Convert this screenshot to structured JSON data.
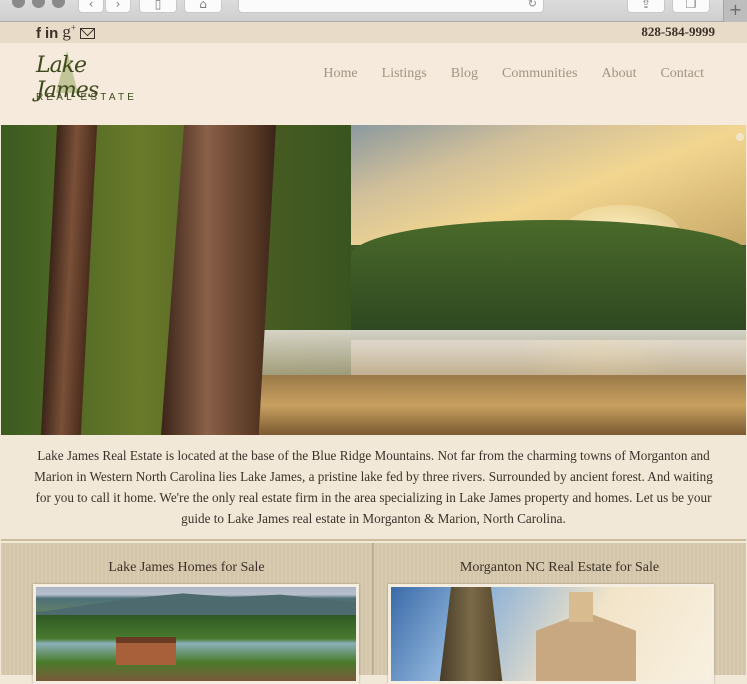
{
  "browser": {
    "back_icon": "‹",
    "forward_icon": "›",
    "sidebar_icon": "▯",
    "home_icon": "⌂",
    "reload_icon": "↻",
    "share_icon": "⇪",
    "tabs_icon": "❐",
    "new_tab_icon": "+"
  },
  "topbar": {
    "social": {
      "facebook": "f",
      "linkedin": "in",
      "googleplus": "g",
      "googleplus_sup": "+"
    },
    "phone": "828-584-9999"
  },
  "header": {
    "logo_script": "Lake James",
    "logo_sub": "REAL ESTATE",
    "nav": [
      {
        "label": "Home"
      },
      {
        "label": "Listings"
      },
      {
        "label": "Blog"
      },
      {
        "label": "Communities"
      },
      {
        "label": "About"
      },
      {
        "label": "Contact"
      }
    ]
  },
  "intro": {
    "text": "Lake James Real Estate is located at the base of the Blue Ridge Mountains. Not far from the charming towns of Morganton and Marion in Western North Carolina lies Lake James, a pristine lake fed by three rivers. Surrounded by ancient forest. And waiting for you to call it home. We're the only real estate firm in the area specializing in Lake James property and homes. Let us be your guide to Lake James real estate in Morganton & Marion, North Carolina."
  },
  "features": [
    {
      "title": "Lake James Homes for Sale"
    },
    {
      "title": "Morganton NC Real Estate for Sale"
    }
  ]
}
